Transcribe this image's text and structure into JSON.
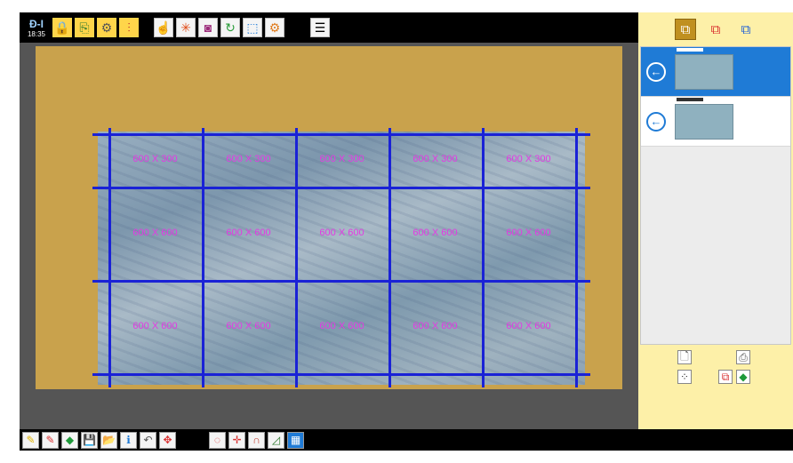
{
  "app": {
    "logo_text": "Đ-I",
    "time": "18:35"
  },
  "top_toolbar": {
    "group1": [
      {
        "name": "lock-icon",
        "glyph": "🔒"
      },
      {
        "name": "export-icon",
        "glyph": "⎘"
      },
      {
        "name": "settings-gear-icon",
        "glyph": "⚙"
      },
      {
        "name": "adjust-sliders-icon",
        "glyph": "⫶"
      }
    ],
    "group2": [
      {
        "name": "pointer-hand-icon",
        "glyph": "☝"
      },
      {
        "name": "star-burst-icon",
        "glyph": "✳"
      },
      {
        "name": "camera-icon",
        "glyph": "◙"
      },
      {
        "name": "refresh-circle-icon",
        "glyph": "↻"
      },
      {
        "name": "select-frame-icon",
        "glyph": "⬚"
      },
      {
        "name": "tag-gear-icon",
        "glyph": "⚙"
      }
    ],
    "menu_glyph": "☰"
  },
  "canvas": {
    "slab_color": "#8fa8bb",
    "background_color": "#c9a24c",
    "grid_color": "#1a22d6",
    "label_color": "#e33ae3",
    "rows": [
      [
        "600 X 300",
        "600 X 300",
        "600 X 300",
        "600 X 300",
        "600 X 300"
      ],
      [
        "600 X 600",
        "600 X 600",
        "600 X 600",
        "600 X 600",
        "600 X 600"
      ],
      [
        "600 X 600",
        "600 X 600",
        "600 X 600",
        "600 X 600",
        "600 X 600"
      ]
    ]
  },
  "right_panel": {
    "top_buttons": [
      {
        "name": "layers-add-icon",
        "glyph": "⧉",
        "active": true
      },
      {
        "name": "layers-remove-icon",
        "glyph": "⧉",
        "active": false
      },
      {
        "name": "layers-info-icon",
        "glyph": "⧉",
        "active": false
      }
    ],
    "arrow_glyph": "←",
    "items": [
      {
        "selected": true
      },
      {
        "selected": false
      }
    ],
    "bottom_buttons": [
      {
        "name": "new-page-icon",
        "glyph": "🗋"
      },
      {
        "name": "print-icon",
        "glyph": "⎙"
      },
      {
        "name": "scatter-dots-icon",
        "glyph": "⁘"
      },
      {
        "name": "remove-layer-icon",
        "glyph": "⧉"
      },
      {
        "name": "eraser-icon",
        "glyph": "◆"
      }
    ]
  },
  "bottom_toolbar": {
    "group1": [
      {
        "name": "pencil-yellow-icon",
        "glyph": "✎"
      },
      {
        "name": "pencil-red-icon",
        "glyph": "✎"
      },
      {
        "name": "eraser-green-icon",
        "glyph": "◆"
      },
      {
        "name": "save-icon",
        "glyph": "💾"
      },
      {
        "name": "open-folder-icon",
        "glyph": "📂"
      },
      {
        "name": "info-icon",
        "glyph": "ℹ"
      },
      {
        "name": "undo-icon",
        "glyph": "↶"
      },
      {
        "name": "move-target-icon",
        "glyph": "✥"
      }
    ],
    "group2": [
      {
        "name": "rotate-dashed-icon",
        "glyph": "◌"
      },
      {
        "name": "move-cross-icon",
        "glyph": "✛"
      },
      {
        "name": "magnet-icon",
        "glyph": "∩"
      },
      {
        "name": "angle-ruler-icon",
        "glyph": "◿"
      },
      {
        "name": "grid-icon",
        "glyph": "▦"
      }
    ]
  }
}
